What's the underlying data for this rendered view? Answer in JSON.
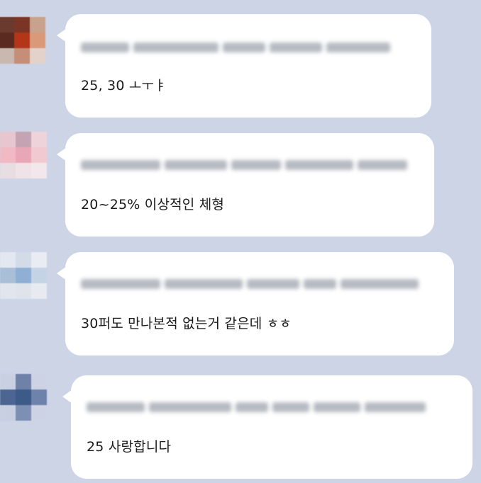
{
  "messages": [
    {
      "text": "25, 30 ㅗㅜㅑ",
      "avatar_colors": [
        "#6a3a2e",
        "#7b3524",
        "#c9a28e",
        "#5a2a20",
        "#b3351a",
        "#d99a7a",
        "#c8b8b0",
        "#c58e78",
        "#e3d2ca"
      ]
    },
    {
      "text": "20~25% 이상적인 체형",
      "avatar_colors": [
        "#e8c6cf",
        "#c4a4b2",
        "#efd3da",
        "#f0b9c4",
        "#e9a7b6",
        "#f1c9d1",
        "#e7dde3",
        "#efe3e7",
        "#f2e8ec"
      ]
    },
    {
      "text": "30퍼도 만나본적 없는거 같은데 ㅎㅎ",
      "avatar_colors": [
        "#e3e7ef",
        "#d4dbe8",
        "#e9edf3",
        "#a9bfd8",
        "#8fb0d4",
        "#c4d4e6",
        "#e1e6ee",
        "#dfe4ec",
        "#e7ebf1"
      ]
    },
    {
      "text": "25 사랑합니다",
      "avatar_colors": [
        "#c9d0e2",
        "#6f81a7",
        "#cdd3e4",
        "#4c6592",
        "#3e5a88",
        "#6d83ab",
        "#c8cfe1",
        "#7d8fb3",
        "#cdd3e4"
      ]
    }
  ]
}
